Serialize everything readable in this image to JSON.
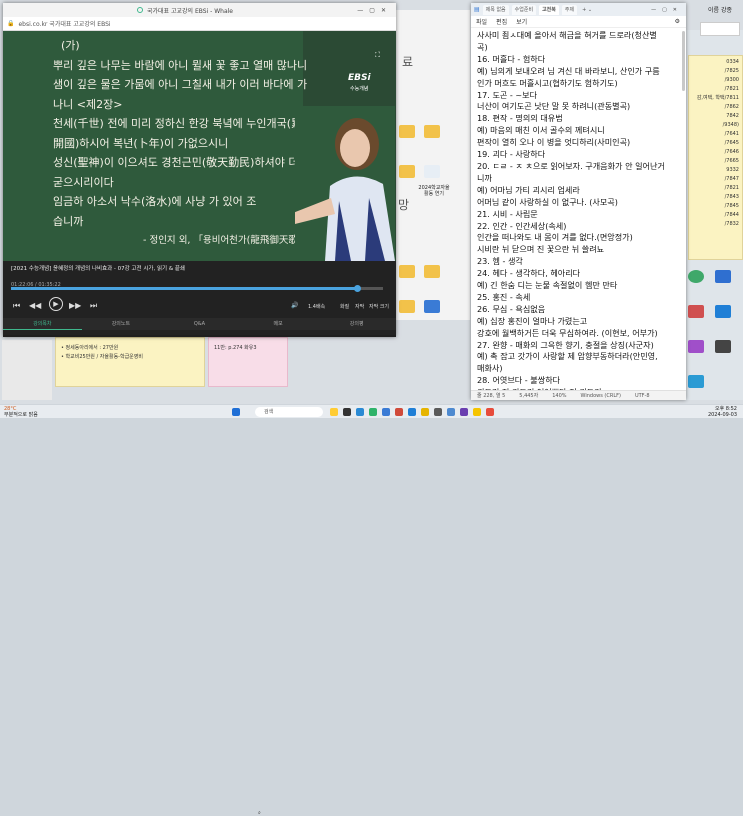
{
  "browser": {
    "title": "국가대표 고교강의 EBSi - Whale",
    "url": "ebsi.co.kr   국가대표 고교강의 EBSi",
    "board": {
      "lines": [
        "(가)",
        "뿌리 깊은 나무는 바람에 아니 뮐새 꽃 좋고 열매 많나니",
        "샘이 깊은 물은 가뭄에 아니 그칠새 내가 이러 바다에 가",
        "나니                                              <제2장>",
        "천세(千世) 전에 미리 정하신 한강 북녘에 누인개국(累仁",
        "開國)하시어 복년(卜年)이 가없으시니",
        "성신(聖神)이 이으셔도 경천근민(敬天勤民)하셔야 더욱",
        "굳으시리이다",
        "임금하 아소서 낙수(洛水)에 사냥 가 있어 조",
        "습니까",
        "- 정인지 외, 「용비어천가(龍飛御天歌)"
      ],
      "logo": "EBSi",
      "logo_sub": "수능개념"
    },
    "player": {
      "video_title": "[2021 수능개념] 윤혜정의 개념의 나비효과 - 07강 고전 시가, 읽기 & 끝쇄",
      "time": "01:22:06 / 01:35:22",
      "progress": 0.93,
      "speed": "1.4배속",
      "quality": "화질",
      "subtitles": "자막",
      "size": "자막 크기"
    },
    "tabs": [
      "강의목차",
      "강의노트",
      "Q&A",
      "메모",
      "강의평"
    ],
    "sticky_left": [
      "• 정세동아리에서 : 27만원",
      "• 학교비25만원 / 자율활동-학급운영비"
    ],
    "sticky_pink": "11반: p.274 화유3"
  },
  "notepad": {
    "tabs": [
      "제목 없음",
      "수업준비",
      "고전북",
      "주제"
    ],
    "menu": [
      "파일",
      "편집",
      "보기"
    ],
    "lines": [
      "사사미 죔ㅅ대예 올아서 해금을 혀거를 드로라(청산별",
      "곡)",
      "16. 머흘다 - 험하다",
      "예) 님의게 보내오려 님 겨신 대 바라보니, 산인가 구름",
      "인가 머흐도 머흘시고(협하기도 험하기도)",
      "17. 도곤 - ~보다",
      "너산이 여기도곤 낫단 말 못 하려니(관동별곡)",
      "18. 편작 - 명의의 대유법",
      "예) 마음의 매친 이서 골수의 께텨시니",
      "편작이 열히 오나 이 병을 엇디하리(사미인곡)",
      "19. 괴다 - 사랑하다",
      "20. ㄷㄹ - ㅈ ㅊ으로 읽어보자. 구개음화가 안 일어난거",
      "니까",
      "예) 어마님 가티 괴시리 업세라",
      "어머님 같이 사랑하실 이 없구나. (사모곡)",
      "21. 시비 - 사립문",
      "22. 인간 - 인간세상(속세)",
      "인간을 떠나와도 내 몸이 겨를 없다.(면앙정가)",
      "시비란 뉘 닫으며 진 꽃으란 뉘 쓸려뇨",
      "23. 헴 - 생각",
      "24. 헤다 - 생각하다, 헤아리다",
      "예) 긴 한숨 디는 눈물 속절없이 헴만 만타",
      "25. 홍진 - 속세",
      "26. 무심 - 욕심없음",
      "예) 십장 홍진이 얼마나 가렸는고",
      "강호에 월백하거든 더욱 무심하여라. (이현보, 어부가)",
      "27. 완향 - 매화의 그윽한 향기, 충절을 상징(사군자)",
      "예) 촉 잡고 갓가이 사랑할 제 암향부동하더라(안민영,",
      "매화사)",
      "28. 어엿브다 - 불쌍하다",
      "귀도리 저 귀도리 어여쁘다 저 귀도리"
    ],
    "status": {
      "position": "줄 228, 열 5",
      "chars": "5,445자",
      "zoom": "140%",
      "eol": "Windows (CRLF)",
      "encoding": "UTF-8"
    }
  },
  "desktop": {
    "right_texts": [
      "0334",
      "/7825",
      "/9300",
      "/7821",
      "감,여택, 학택/7811",
      "/7862",
      "7842",
      "/9348)",
      "/7641",
      "/7645",
      "/7646",
      "/7665",
      "9332",
      "/7847",
      "/7821",
      "/7843",
      "/7845",
      "/7844",
      "/7832"
    ],
    "side_labels": [
      "2024학교자율활동 연기",
      "2024고1 맞춤형 교 과 학습...",
      "2023고의 2024학교 교과 표체"
    ],
    "widget_label": "이름  강종"
  },
  "taskbar": {
    "weather_temp": "28°C",
    "weather_desc": "부분적으로 맑음",
    "search_placeholder": "검색",
    "time": "오후 8:52",
    "date": "2024-09-03"
  }
}
